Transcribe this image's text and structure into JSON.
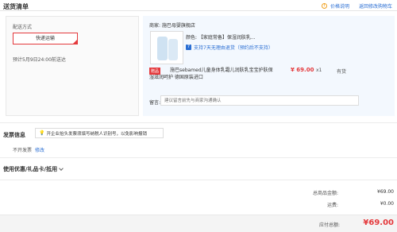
{
  "header": {
    "title": "送货清单",
    "price_note": "价格说明",
    "back_to_cart": "返回修改购物车"
  },
  "shipping": {
    "label": "配送方式",
    "method": "快递运输",
    "estimate": "预计5月9日24:00前送达"
  },
  "shop": {
    "name": "商家: 施巴母婴旗舰店",
    "product": {
      "color_label": "颜色: 【家庭常备】保湿润肤乳...",
      "return_policy": "支持7天无理由退货（预约后不支持）",
      "gift_tag": "赠品",
      "name": "施巴sebamed儿童身体乳霜儿润肤乳宝宝护肤保湿滋润呵护 德国原装进口",
      "price": "¥ 69.00",
      "qty": "x1",
      "stock": "有货"
    },
    "remark_label": "留言:",
    "remark_placeholder": "建议留言前先与商家沟通确认"
  },
  "invoice": {
    "title": "发票信息",
    "tip": "开企业抬头发票须填写纳税人识别号，以免影响报销",
    "status": "不开发票",
    "edit": "修改"
  },
  "coupon": {
    "label": "使用优惠/礼品卡/抵用"
  },
  "totals": {
    "goods_label": "总商品金额:",
    "goods_value": "¥69.00",
    "shipping_label": "运费:",
    "shipping_value": "¥0.00",
    "pay_label": "应付总额:",
    "pay_value": "¥69.00"
  },
  "colors": {
    "accent_red": "#e4393c",
    "link_blue": "#2a6ed3",
    "shop_bg": "#f3f8fe"
  }
}
